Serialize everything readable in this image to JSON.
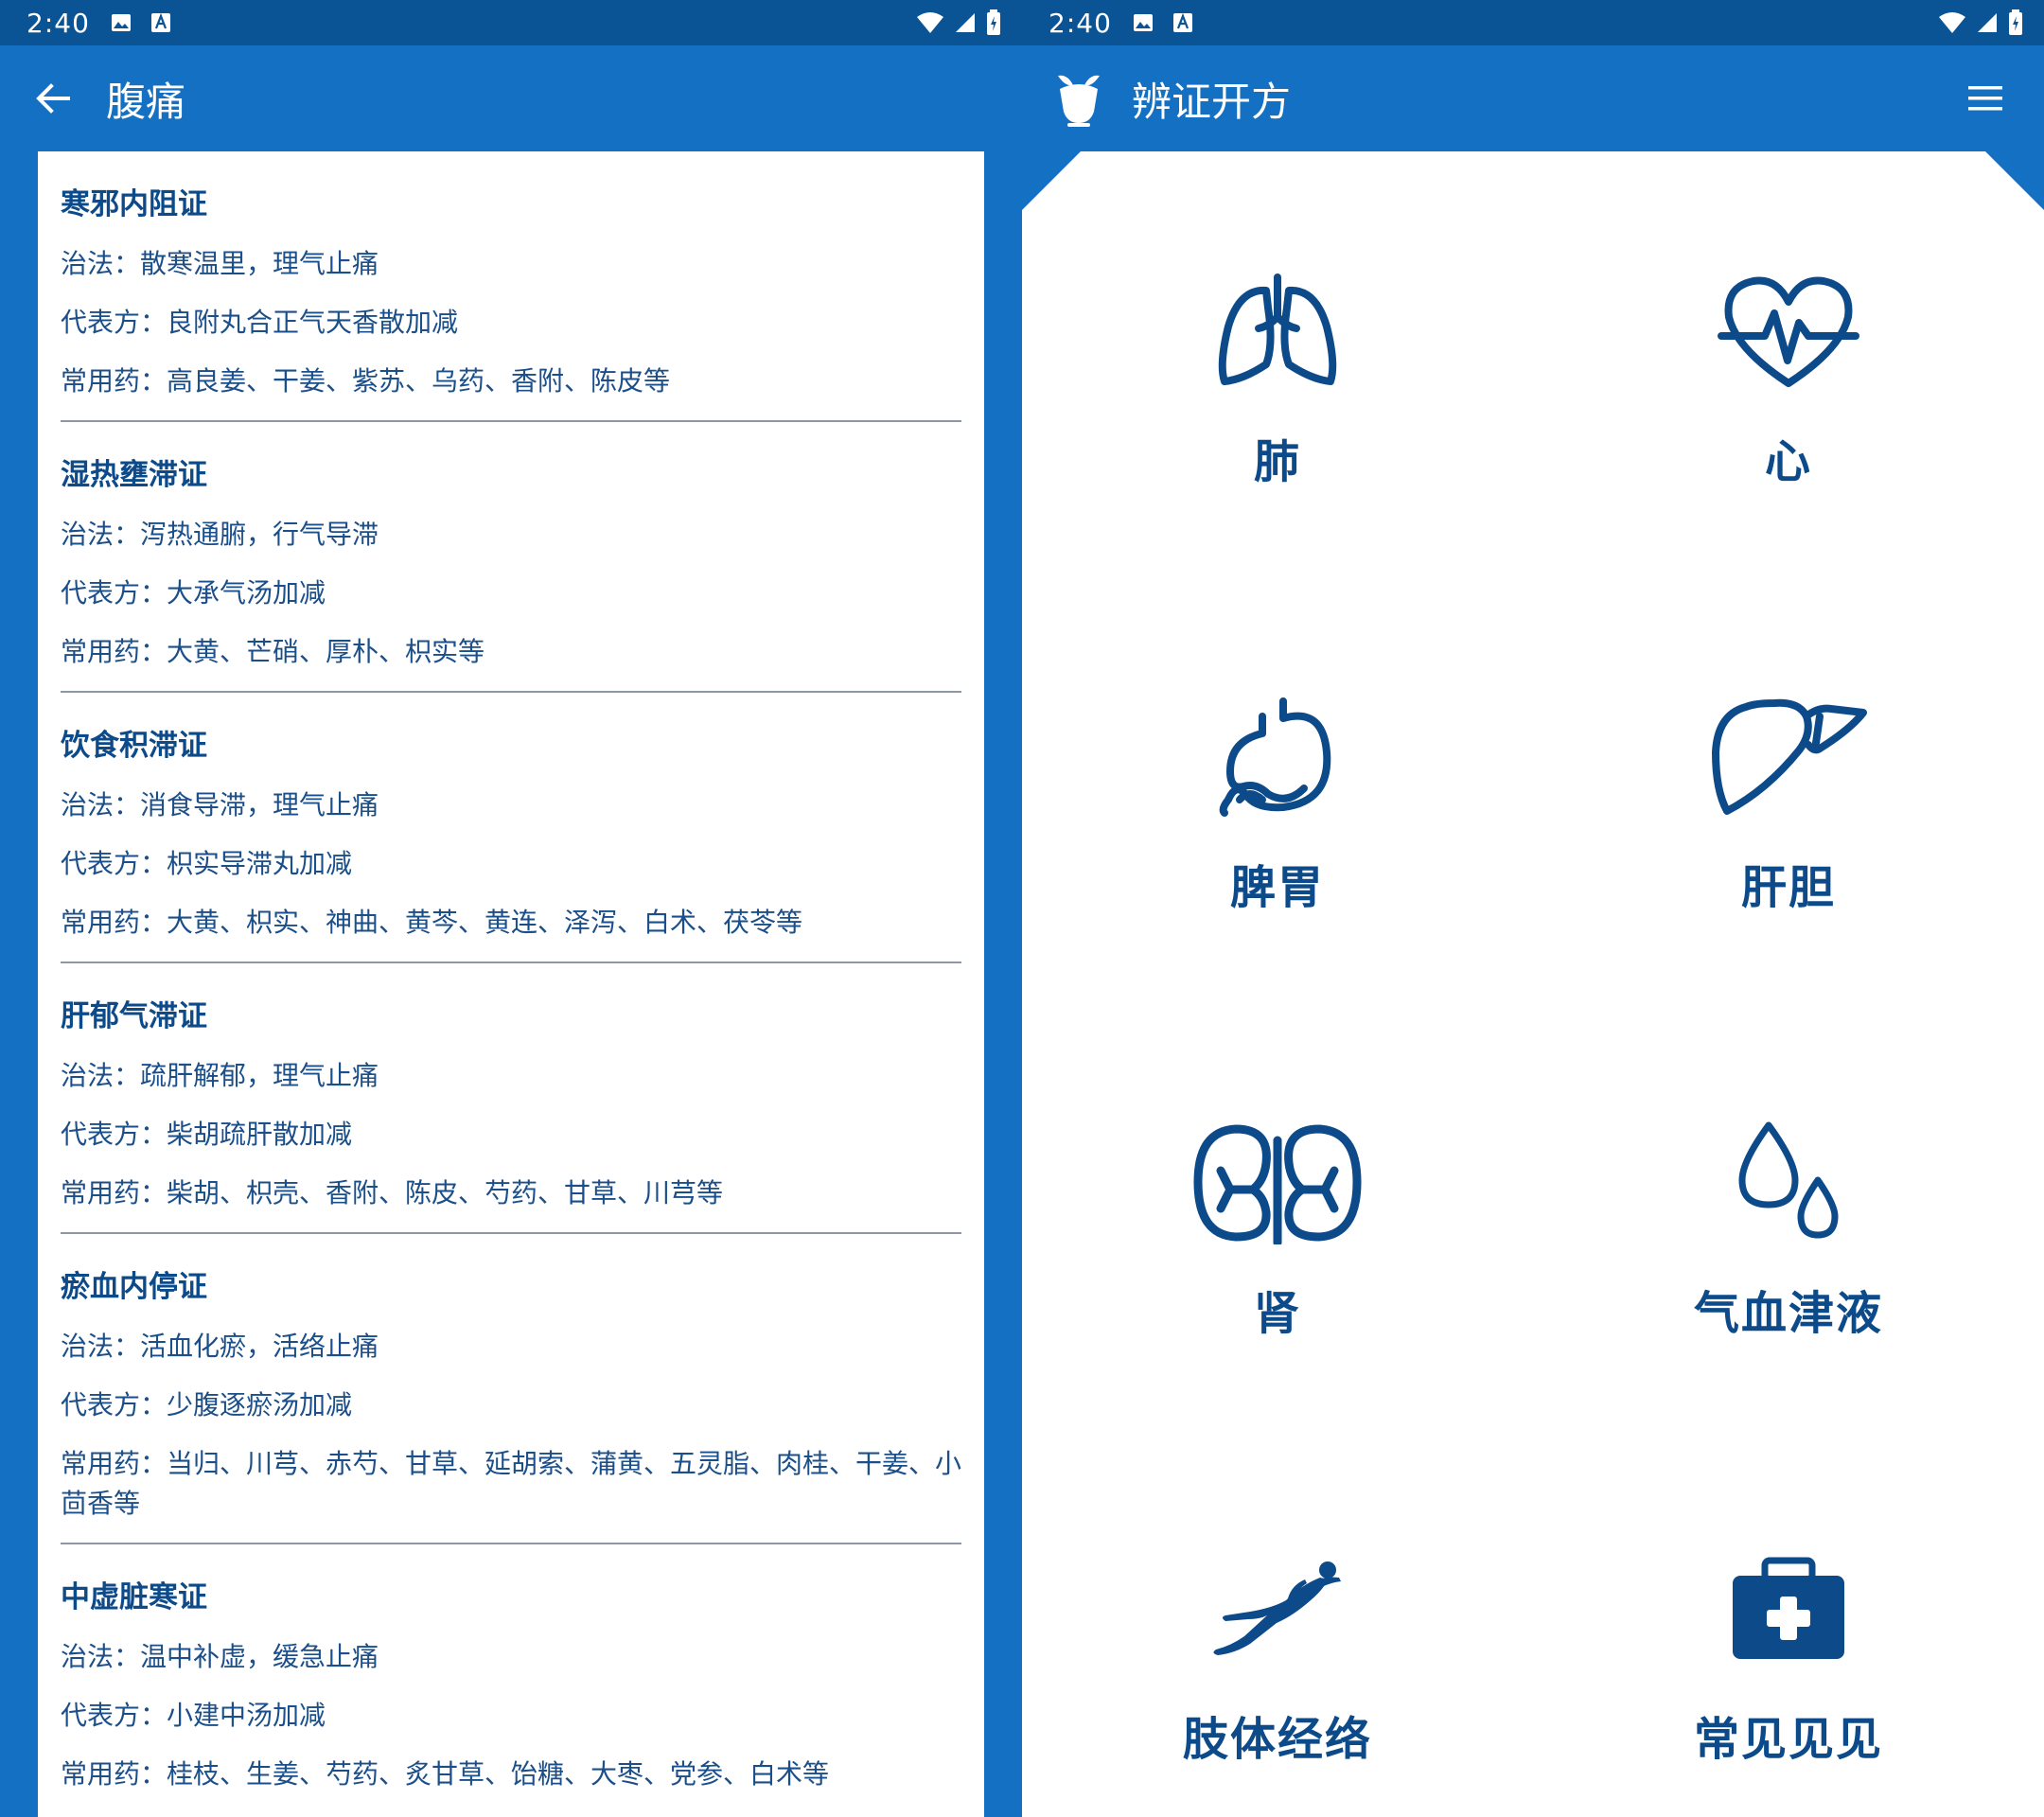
{
  "status": {
    "time": "2:40"
  },
  "left": {
    "title": "腹痛",
    "syndromes": [
      {
        "name": "寒邪内阻证",
        "treatment": "治法：散寒温里，理气止痛",
        "formula": "代表方：良附丸合正气天香散加减",
        "herbs": "常用药：高良姜、干姜、紫苏、乌药、香附、陈皮等"
      },
      {
        "name": "湿热壅滞证",
        "treatment": "治法：泻热通腑，行气导滞",
        "formula": "代表方：大承气汤加减",
        "herbs": "常用药：大黄、芒硝、厚朴、枳实等"
      },
      {
        "name": "饮食积滞证",
        "treatment": "治法：消食导滞，理气止痛",
        "formula": "代表方：枳实导滞丸加减",
        "herbs": "常用药：大黄、枳实、神曲、黄芩、黄连、泽泻、白术、茯苓等"
      },
      {
        "name": "肝郁气滞证",
        "treatment": "治法：疏肝解郁，理气止痛",
        "formula": "代表方：柴胡疏肝散加减",
        "herbs": "常用药：柴胡、枳壳、香附、陈皮、芍药、甘草、川芎等"
      },
      {
        "name": "瘀血内停证",
        "treatment": "治法：活血化瘀，活络止痛",
        "formula": "代表方：少腹逐瘀汤加减",
        "herbs": "常用药：当归、川芎、赤芍、甘草、延胡索、蒲黄、五灵脂、肉桂、干姜、小茴香等"
      },
      {
        "name": "中虚脏寒证",
        "treatment": "治法：温中补虚，缓急止痛",
        "formula": "代表方：小建中汤加减",
        "herbs": "常用药：桂枝、生姜、芍药、炙甘草、饴糖、大枣、党参、白术等"
      }
    ]
  },
  "right": {
    "title": "辨证开方",
    "tiles": [
      {
        "label": "肺",
        "icon": "lungs-icon"
      },
      {
        "label": "心",
        "icon": "heart-icon"
      },
      {
        "label": "脾胃",
        "icon": "stomach-icon"
      },
      {
        "label": "肝胆",
        "icon": "liver-icon"
      },
      {
        "label": "肾",
        "icon": "kidneys-icon"
      },
      {
        "label": "气血津液",
        "icon": "drops-icon"
      },
      {
        "label": "肢体经络",
        "icon": "body-icon"
      },
      {
        "label": "常见见见",
        "icon": "first-aid-kit-icon"
      }
    ]
  },
  "colors": {
    "primary": "#1470c2",
    "statusbar": "#0a5394",
    "icon": "#0c4a8a",
    "text": "#1b4f8a"
  }
}
